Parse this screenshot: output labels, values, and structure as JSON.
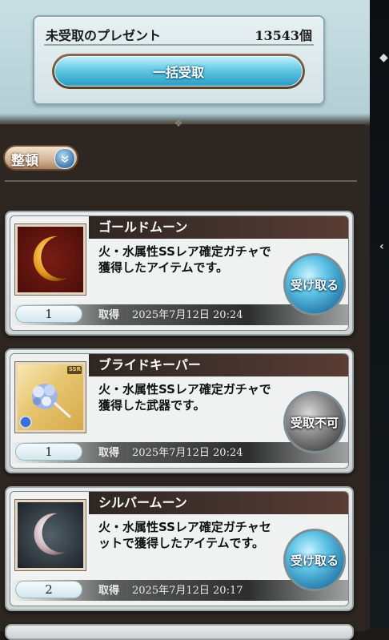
{
  "present": {
    "title": "未受取のプレゼント",
    "count": "13543個",
    "bulk_button": "一括受取"
  },
  "sort": {
    "label": "整頓"
  },
  "items": [
    {
      "name": "ゴールドムーン",
      "desc": "火・水属性SSレア確定ガチャで獲得したアイテムです。",
      "qty": "1",
      "acq_label": "取得",
      "acq_date": "2025年7月12日 20:24",
      "button": "受け取る",
      "button_state": "enabled"
    },
    {
      "name": "ブライドキーパー",
      "desc": "火・水属性SSレア確定ガチャで獲得した武器です。",
      "qty": "1",
      "acq_label": "取得",
      "acq_date": "2025年7月12日 20:24",
      "button": "受取不可",
      "button_state": "disabled",
      "rarity_badge": "SSR"
    },
    {
      "name": "シルバームーン",
      "desc": "火・水属性SSレア確定ガチャセットで獲得したアイテムです。",
      "qty": "2",
      "acq_label": "取得",
      "acq_date": "2025年7月12日 20:17",
      "button": "受け取る",
      "button_state": "enabled"
    }
  ],
  "icons": {
    "sort": "chevron-down-icon",
    "gold_moon": "gold-crescent-moon-icon",
    "bride_keeper": "bouquet-weapon-icon",
    "silver_moon": "silver-crescent-moon-icon"
  }
}
